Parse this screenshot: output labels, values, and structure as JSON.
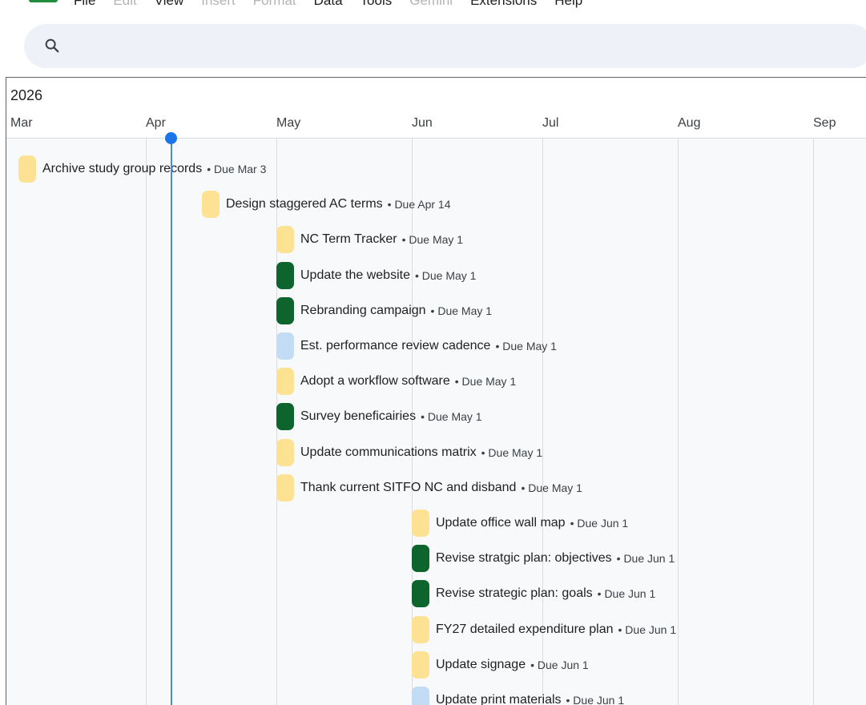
{
  "menu": {
    "items": [
      {
        "label": "File",
        "enabled": true
      },
      {
        "label": "Edit",
        "enabled": false
      },
      {
        "label": "View",
        "enabled": true
      },
      {
        "label": "Insert",
        "enabled": false
      },
      {
        "label": "Format",
        "enabled": false
      },
      {
        "label": "Data",
        "enabled": true
      },
      {
        "label": "Tools",
        "enabled": true
      },
      {
        "label": "Gemini",
        "enabled": false
      },
      {
        "label": "Extensions",
        "enabled": true
      },
      {
        "label": "Help",
        "enabled": true
      }
    ]
  },
  "search": {
    "icon": "search-icon"
  },
  "timeline": {
    "year": "2026",
    "months": [
      "Mar",
      "Apr",
      "May",
      "Jun",
      "Jul",
      "Aug",
      "Sep"
    ]
  },
  "colors": {
    "yellow": "#fde293",
    "green": "#0d652d",
    "blue": "#c2dcf5",
    "today": "#1a73e8"
  },
  "tasks": [
    {
      "title": "Archive study group records",
      "due": "• Due Mar 3",
      "color": "yellow"
    },
    {
      "title": "Design staggered AC terms",
      "due": "• Due Apr 14",
      "color": "yellow"
    },
    {
      "title": "NC Term Tracker",
      "due": "• Due May 1",
      "color": "yellow"
    },
    {
      "title": "Update the website",
      "due": "• Due May 1",
      "color": "green"
    },
    {
      "title": "Rebranding campaign",
      "due": "• Due May 1",
      "color": "green"
    },
    {
      "title": "Est. performance review cadence",
      "due": "• Due May 1",
      "color": "blue"
    },
    {
      "title": "Adopt a workflow software",
      "due": "• Due May 1",
      "color": "yellow"
    },
    {
      "title": "Survey beneficairies",
      "due": "• Due May 1",
      "color": "green"
    },
    {
      "title": "Update communications matrix",
      "due": "• Due May 1",
      "color": "yellow"
    },
    {
      "title": "Thank current SITFO NC and disband",
      "due": "• Due May 1",
      "color": "yellow"
    },
    {
      "title": "Update office wall map",
      "due": "• Due Jun 1",
      "color": "yellow"
    },
    {
      "title": "Revise stratgic plan: objectives",
      "due": "• Due Jun 1",
      "color": "green"
    },
    {
      "title": "Revise strategic plan: goals",
      "due": "• Due Jun 1",
      "color": "green"
    },
    {
      "title": "FY27 detailed expenditure plan",
      "due": "• Due Jun 1",
      "color": "yellow"
    },
    {
      "title": "Update signage",
      "due": "• Due Jun 1",
      "color": "yellow"
    },
    {
      "title": "Update print materials",
      "due": "• Due Jun 1",
      "color": "blue"
    }
  ]
}
